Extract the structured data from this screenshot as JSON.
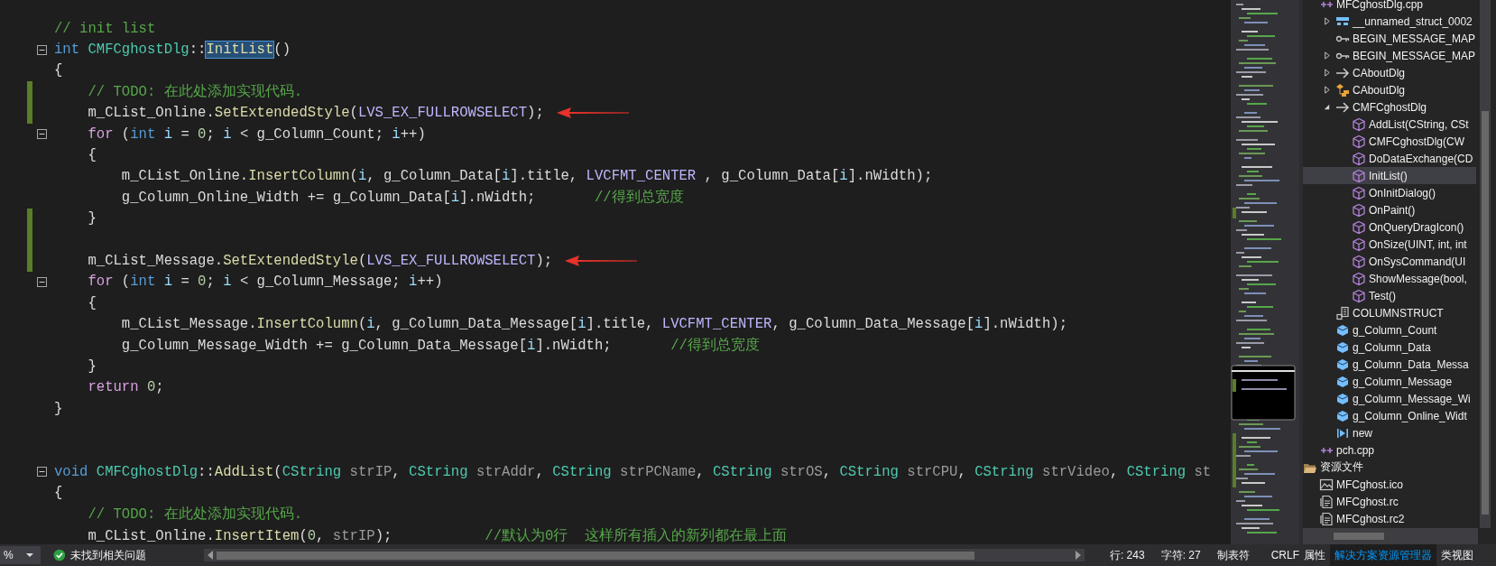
{
  "editor": {
    "lines": [
      {
        "changed": false,
        "fold": false,
        "arrow": false,
        "tokens": [
          {
            "kind": "comment",
            "text": "// init list"
          }
        ]
      },
      {
        "changed": false,
        "fold": true,
        "arrow": false,
        "tokens": [
          {
            "kind": "keyword",
            "text": "int "
          },
          {
            "kind": "type",
            "text": "CMFCghostDlg"
          },
          {
            "kind": "plain",
            "text": "::"
          },
          {
            "kind": "match",
            "text": "InitList"
          },
          {
            "kind": "plain",
            "text": "()"
          }
        ]
      },
      {
        "changed": false,
        "fold": false,
        "arrow": false,
        "tokens": [
          {
            "kind": "plain",
            "text": "{"
          }
        ]
      },
      {
        "changed": true,
        "fold": false,
        "arrow": false,
        "tokens": [
          {
            "kind": "comment",
            "text": "    // TODO: 在此处添加实现代码."
          }
        ]
      },
      {
        "changed": true,
        "fold": false,
        "arrow": true,
        "tokens": [
          {
            "kind": "plain",
            "text": "    m_CList_Online."
          },
          {
            "kind": "function",
            "text": "SetExtendedStyle"
          },
          {
            "kind": "plain",
            "text": "("
          },
          {
            "kind": "macro",
            "text": "LVS_EX_FULLROWSELECT"
          },
          {
            "kind": "plain",
            "text": ");"
          }
        ]
      },
      {
        "changed": false,
        "fold": true,
        "arrow": false,
        "tokens": [
          {
            "kind": "control",
            "text": "    for"
          },
          {
            "kind": "plain",
            "text": " ("
          },
          {
            "kind": "keyword",
            "text": "int "
          },
          {
            "kind": "local",
            "text": "i"
          },
          {
            "kind": "plain",
            "text": " = "
          },
          {
            "kind": "number",
            "text": "0"
          },
          {
            "kind": "plain",
            "text": "; "
          },
          {
            "kind": "local",
            "text": "i"
          },
          {
            "kind": "plain",
            "text": " < g_Column_Count; "
          },
          {
            "kind": "local",
            "text": "i"
          },
          {
            "kind": "plain",
            "text": "++)"
          }
        ]
      },
      {
        "changed": false,
        "fold": false,
        "arrow": false,
        "tokens": [
          {
            "kind": "plain",
            "text": "    {"
          }
        ]
      },
      {
        "changed": false,
        "fold": false,
        "arrow": false,
        "tokens": [
          {
            "kind": "plain",
            "text": "        m_CList_Online."
          },
          {
            "kind": "function",
            "text": "InsertColumn"
          },
          {
            "kind": "plain",
            "text": "("
          },
          {
            "kind": "local",
            "text": "i"
          },
          {
            "kind": "plain",
            "text": ", g_Column_Data["
          },
          {
            "kind": "local",
            "text": "i"
          },
          {
            "kind": "plain",
            "text": "].title, "
          },
          {
            "kind": "macro",
            "text": "LVCFMT_CENTER"
          },
          {
            "kind": "plain",
            "text": " , g_Column_Data["
          },
          {
            "kind": "local",
            "text": "i"
          },
          {
            "kind": "plain",
            "text": "].nWidth);"
          }
        ]
      },
      {
        "changed": false,
        "fold": false,
        "arrow": false,
        "tokens": [
          {
            "kind": "plain",
            "text": "        g_Column_Online_Width += g_Column_Data["
          },
          {
            "kind": "local",
            "text": "i"
          },
          {
            "kind": "plain",
            "text": "].nWidth;"
          },
          {
            "kind": "comment",
            "text": "       //得到总宽度"
          }
        ]
      },
      {
        "changed": true,
        "fold": false,
        "arrow": false,
        "tokens": [
          {
            "kind": "plain",
            "text": "    }"
          }
        ]
      },
      {
        "changed": true,
        "fold": false,
        "arrow": false
      },
      {
        "changed": true,
        "fold": false,
        "arrow": true,
        "tokens": [
          {
            "kind": "plain",
            "text": "    m_CList_Message."
          },
          {
            "kind": "function",
            "text": "SetExtendedStyle"
          },
          {
            "kind": "plain",
            "text": "("
          },
          {
            "kind": "macro",
            "text": "LVS_EX_FULLROWSELECT"
          },
          {
            "kind": "plain",
            "text": ");"
          }
        ]
      },
      {
        "changed": false,
        "fold": true,
        "arrow": false,
        "tokens": [
          {
            "kind": "control",
            "text": "    for"
          },
          {
            "kind": "plain",
            "text": " ("
          },
          {
            "kind": "keyword",
            "text": "int "
          },
          {
            "kind": "local",
            "text": "i"
          },
          {
            "kind": "plain",
            "text": " = "
          },
          {
            "kind": "number",
            "text": "0"
          },
          {
            "kind": "plain",
            "text": "; "
          },
          {
            "kind": "local",
            "text": "i"
          },
          {
            "kind": "plain",
            "text": " < g_Column_Message; "
          },
          {
            "kind": "local",
            "text": "i"
          },
          {
            "kind": "plain",
            "text": "++)"
          }
        ]
      },
      {
        "changed": false,
        "fold": false,
        "arrow": false,
        "tokens": [
          {
            "kind": "plain",
            "text": "    {"
          }
        ]
      },
      {
        "changed": false,
        "fold": false,
        "arrow": false,
        "tokens": [
          {
            "kind": "plain",
            "text": "        m_CList_Message."
          },
          {
            "kind": "function",
            "text": "InsertColumn"
          },
          {
            "kind": "plain",
            "text": "("
          },
          {
            "kind": "local",
            "text": "i"
          },
          {
            "kind": "plain",
            "text": ", g_Column_Data_Message["
          },
          {
            "kind": "local",
            "text": "i"
          },
          {
            "kind": "plain",
            "text": "].title, "
          },
          {
            "kind": "macro",
            "text": "LVCFMT_CENTER"
          },
          {
            "kind": "plain",
            "text": ", g_Column_Data_Message["
          },
          {
            "kind": "local",
            "text": "i"
          },
          {
            "kind": "plain",
            "text": "].nWidth);"
          }
        ]
      },
      {
        "changed": false,
        "fold": false,
        "arrow": false,
        "tokens": [
          {
            "kind": "plain",
            "text": "        g_Column_Message_Width += g_Column_Data_Message["
          },
          {
            "kind": "local",
            "text": "i"
          },
          {
            "kind": "plain",
            "text": "].nWidth;"
          },
          {
            "kind": "comment",
            "text": "       //得到总宽度"
          }
        ]
      },
      {
        "changed": false,
        "fold": false,
        "arrow": false,
        "tokens": [
          {
            "kind": "plain",
            "text": "    }"
          }
        ]
      },
      {
        "changed": false,
        "fold": false,
        "arrow": false,
        "tokens": [
          {
            "kind": "control",
            "text": "    return "
          },
          {
            "kind": "number",
            "text": "0"
          },
          {
            "kind": "plain",
            "text": ";"
          }
        ]
      },
      {
        "changed": false,
        "fold": false,
        "arrow": false,
        "tokens": [
          {
            "kind": "plain",
            "text": "}"
          }
        ]
      },
      {
        "changed": false,
        "fold": false,
        "arrow": false
      },
      {
        "changed": false,
        "fold": false,
        "arrow": false
      },
      {
        "changed": false,
        "fold": true,
        "arrow": false,
        "tokens": [
          {
            "kind": "keyword",
            "text": "void "
          },
          {
            "kind": "type",
            "text": "CMFCghostDlg"
          },
          {
            "kind": "plain",
            "text": "::"
          },
          {
            "kind": "function",
            "text": "AddList"
          },
          {
            "kind": "plain",
            "text": "("
          },
          {
            "kind": "type",
            "text": "CString "
          },
          {
            "kind": "param",
            "text": "strIP"
          },
          {
            "kind": "plain",
            "text": ", "
          },
          {
            "kind": "type",
            "text": "CString "
          },
          {
            "kind": "param",
            "text": "strAddr"
          },
          {
            "kind": "plain",
            "text": ", "
          },
          {
            "kind": "type",
            "text": "CString "
          },
          {
            "kind": "param",
            "text": "strPCName"
          },
          {
            "kind": "plain",
            "text": ", "
          },
          {
            "kind": "type",
            "text": "CString "
          },
          {
            "kind": "param",
            "text": "strOS"
          },
          {
            "kind": "plain",
            "text": ", "
          },
          {
            "kind": "type",
            "text": "CString "
          },
          {
            "kind": "param",
            "text": "strCPU"
          },
          {
            "kind": "plain",
            "text": ", "
          },
          {
            "kind": "type",
            "text": "CString "
          },
          {
            "kind": "param",
            "text": "strVideo"
          },
          {
            "kind": "plain",
            "text": ", "
          },
          {
            "kind": "type",
            "text": "CString "
          },
          {
            "kind": "param",
            "text": "st"
          }
        ]
      },
      {
        "changed": false,
        "fold": false,
        "arrow": false,
        "tokens": [
          {
            "kind": "plain",
            "text": "{"
          }
        ]
      },
      {
        "changed": false,
        "fold": false,
        "arrow": false,
        "tokens": [
          {
            "kind": "comment",
            "text": "    // TODO: 在此处添加实现代码."
          }
        ]
      },
      {
        "changed": false,
        "fold": false,
        "arrow": false,
        "tokens": [
          {
            "kind": "plain",
            "text": "    m_CList_Online."
          },
          {
            "kind": "function",
            "text": "InsertItem"
          },
          {
            "kind": "plain",
            "text": "("
          },
          {
            "kind": "number",
            "text": "0"
          },
          {
            "kind": "plain",
            "text": ", "
          },
          {
            "kind": "param",
            "text": "strIP"
          },
          {
            "kind": "plain",
            "text": ");"
          },
          {
            "kind": "comment",
            "text": "           //默认为0行  这样所有插入的新列都在最上面"
          }
        ]
      }
    ]
  },
  "explorer": {
    "items": [
      {
        "kind": "cpp",
        "label": "MFCghostDlg.cpp",
        "selected": false,
        "children": [
          {
            "kind": "struct",
            "label": "__unnamed_struct_0002",
            "selected": false,
            "expanded": false
          },
          {
            "kind": "macro",
            "label": "BEGIN_MESSAGE_MAP",
            "selected": false
          },
          {
            "kind": "macro",
            "label": "BEGIN_MESSAGE_MAP",
            "selected": false,
            "expanded": false
          },
          {
            "kind": "class",
            "label": "CAboutDlg",
            "selected": false,
            "expanded": false
          },
          {
            "kind": "class-alt",
            "label": "CAboutDlg",
            "selected": false,
            "expanded": false
          },
          {
            "kind": "class",
            "label": "CMFCghostDlg",
            "selected": false,
            "expanded": true,
            "children": [
              {
                "kind": "method",
                "label": "AddList(CString, CSt",
                "selected": false
              },
              {
                "kind": "method",
                "label": "CMFCghostDlg(CW",
                "selected": false
              },
              {
                "kind": "method",
                "label": "DoDataExchange(CD",
                "selected": false
              },
              {
                "kind": "method",
                "label": "InitList()",
                "selected": true
              },
              {
                "kind": "method",
                "label": "OnInitDialog()",
                "selected": false
              },
              {
                "kind": "method",
                "label": "OnPaint()",
                "selected": false
              },
              {
                "kind": "method",
                "label": "OnQueryDragIcon()",
                "selected": false
              },
              {
                "kind": "method",
                "label": "OnSize(UINT, int, int",
                "selected": false
              },
              {
                "kind": "method",
                "label": "OnSysCommand(UI",
                "selected": false
              },
              {
                "kind": "method",
                "label": "ShowMessage(bool,",
                "selected": false
              },
              {
                "kind": "method",
                "label": "Test()",
                "selected": false
              }
            ]
          },
          {
            "kind": "typedef",
            "label": "COLUMNSTRUCT",
            "selected": false
          },
          {
            "kind": "variable",
            "label": "g_Column_Count",
            "selected": false
          },
          {
            "kind": "variable",
            "label": "g_Column_Data",
            "selected": false
          },
          {
            "kind": "variable",
            "label": "g_Column_Data_Messa",
            "selected": false
          },
          {
            "kind": "variable",
            "label": "g_Column_Message",
            "selected": false
          },
          {
            "kind": "variable",
            "label": "g_Column_Message_Wi",
            "selected": false
          },
          {
            "kind": "variable",
            "label": "g_Column_Online_Widt",
            "selected": false
          },
          {
            "kind": "operator",
            "label": "new",
            "selected": false
          }
        ]
      },
      {
        "kind": "cpp",
        "label": "pch.cpp",
        "selected": false
      },
      {
        "kind": "folder",
        "label": "资源文件",
        "selected": false,
        "children": [
          {
            "kind": "image",
            "label": "MFCghost.ico",
            "selected": false
          },
          {
            "kind": "resource",
            "label": "MFCghost.rc",
            "selected": false
          },
          {
            "kind": "resource",
            "label": "MFCghost.rc2",
            "selected": false
          }
        ]
      }
    ]
  },
  "status_bar": {
    "zoom": "%",
    "issues": "未找到相关问题",
    "line": "行: 243",
    "column": "字符: 27",
    "indent": "制表符",
    "line_ending": "CRLF"
  },
  "tool_tabs": [
    {
      "label": "属性",
      "selected": false
    },
    {
      "label": "解决方案资源管理器",
      "selected": true
    },
    {
      "label": "类视图",
      "selected": false
    }
  ]
}
